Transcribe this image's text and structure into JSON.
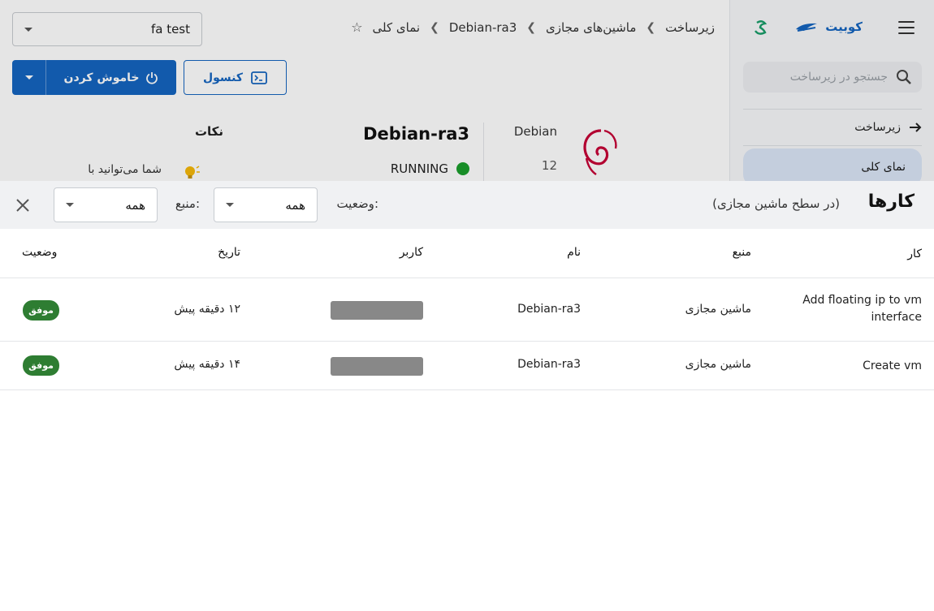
{
  "sidebar": {
    "brand": "کوبیت",
    "search_placeholder": "جستجو در زیرساخت",
    "back_label": "زیرساخت",
    "active_item": "نمای کلی"
  },
  "topbar": {
    "project_select": "fa test",
    "breadcrumb": [
      "زیرساخت",
      "ماشین‌های مجازی",
      "Debian-ra3",
      "نمای کلی"
    ]
  },
  "actions": {
    "shutdown_label": "خاموش کردن",
    "console_label": "کنسول"
  },
  "vm": {
    "name": "Debian-ra3",
    "status": "RUNNING",
    "os": "Debian",
    "version": "12"
  },
  "tips": {
    "title": "نکات",
    "text": "شما می‌توانید با"
  },
  "jobs": {
    "title": "کارها",
    "subtitle": "(در سطح ماشین مجازی)",
    "status_filter_label": "وضعیت:",
    "status_filter_value": "همه",
    "source_filter_label": "منبع:",
    "source_filter_value": "همه",
    "columns": {
      "job": "کار",
      "source": "منبع",
      "name": "نام",
      "user": "کاربر",
      "date": "تاریخ",
      "status": "وضعیت"
    },
    "rows": [
      {
        "job": "Add floating ip to vm interface",
        "source": "ماشین مجازی",
        "name": "Debian-ra3",
        "date": "۱۲ دقیقه پیش",
        "status": "موفق"
      },
      {
        "job": "Create vm",
        "source": "ماشین مجازی",
        "name": "Debian-ra3",
        "date": "۱۴ دقیقه پیش",
        "status": "موفق"
      }
    ]
  },
  "colors": {
    "primary": "#1565c0",
    "success": "#2e7d32",
    "running": "#1a9e2c"
  }
}
